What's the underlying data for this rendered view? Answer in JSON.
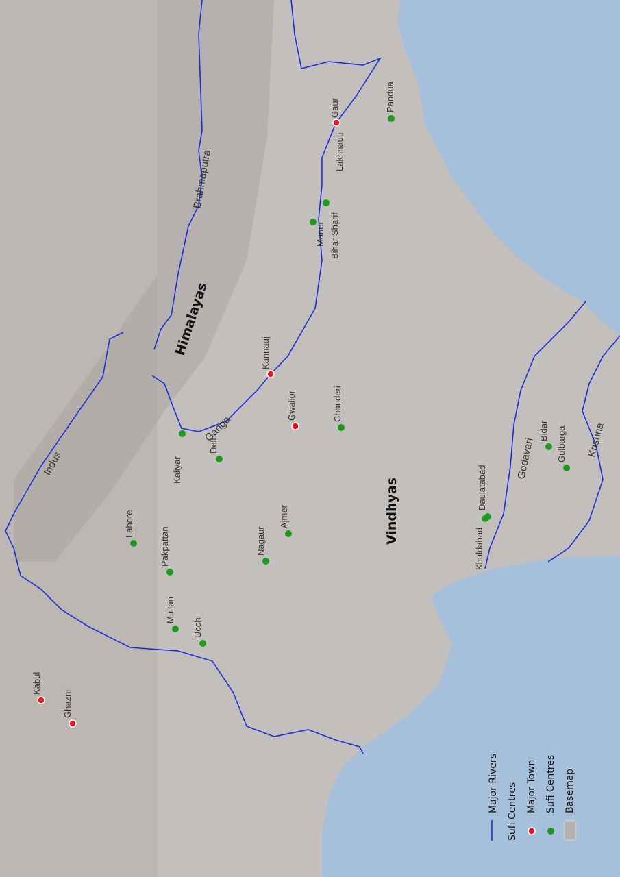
{
  "colors": {
    "land": "#c3bfbc",
    "sea": "#a6c0dc",
    "river": "#1a2fd6",
    "major_town": "#e8141c",
    "sufi_centre": "#1e9a1e"
  },
  "places": {
    "gaur": "Gaur",
    "lakhnauti": "Lakhnauti",
    "pandua": "Pandua",
    "bihar_sharif": "Bihar Sharif",
    "maner": "Maner",
    "kannauj": "Kannauj",
    "gwalior": "Gwalior",
    "chanderi": "Chanderi",
    "kaliyar": "Kaliyar",
    "delhi": "Delhi",
    "lahore": "Lahore",
    "pakpattan": "Pakpattan",
    "nagaur": "Nagaur",
    "ajmer": "Ajmer",
    "multan": "Multan",
    "ucch": "Ucch",
    "kabul": "Kabul",
    "ghazni": "Ghazni",
    "daulatabad": "Daulatabad",
    "khuldabad": "Khuldabad",
    "bidar": "Bidar",
    "gulbarga": "Gulbarga"
  },
  "physical": {
    "himalayas": "Himalayas",
    "vindhyas": "Vindhyas"
  },
  "rivers": {
    "indus": "Indus",
    "brahmaputra": "Brahmaputra",
    "ganga": "Ganga",
    "godavari": "Godavari",
    "krishna": "Krishna"
  },
  "legend": {
    "rivers": "Major Rivers",
    "heading": "Sufi Centres",
    "major_town": "Major Town",
    "sufi_centres": "Sufi Centres",
    "basemap": "Basemap"
  }
}
